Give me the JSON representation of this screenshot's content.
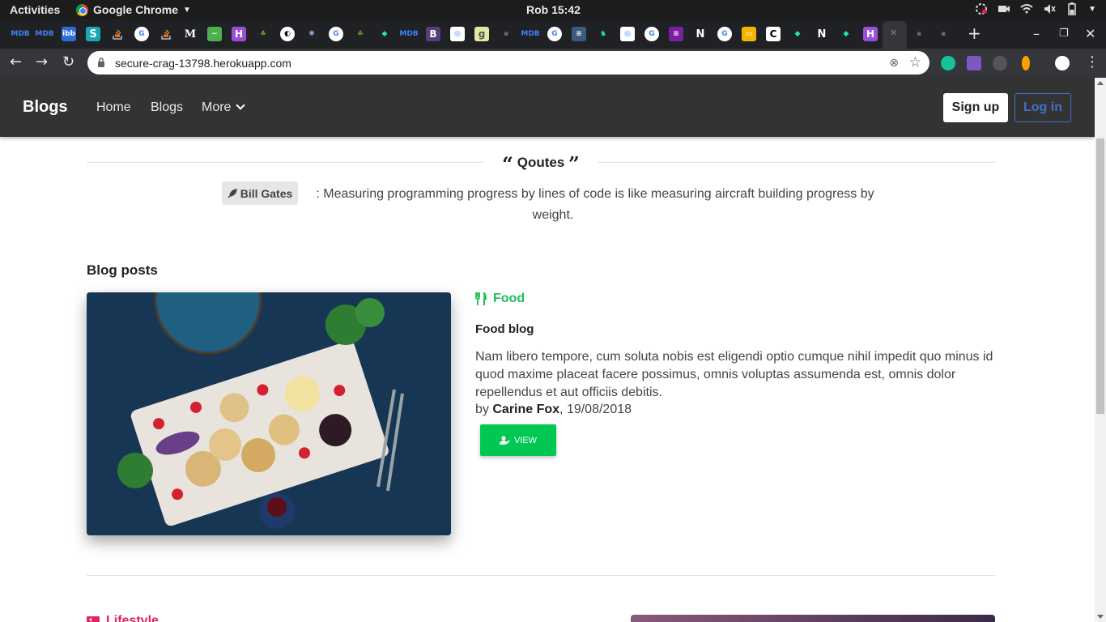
{
  "os": {
    "activities": "Activities",
    "app_name": "Google Chrome",
    "clock": "Rob 15:42"
  },
  "browser": {
    "url": "secure-crag-13798.herokuapp.com",
    "tab_labels": [
      "MDB",
      "MDB",
      "ibb",
      "S",
      "M",
      "H",
      "B",
      "g",
      "N",
      "C",
      "N"
    ]
  },
  "site": {
    "brand": "Blogs",
    "nav": {
      "home": "Home",
      "blogs": "Blogs",
      "more": "More"
    },
    "signup": "Sign up",
    "login": "Log in"
  },
  "quotes": {
    "heading": "Qoutes",
    "author": "Bill Gates",
    "text": ": Measuring programming progress by lines of code is like measuring aircraft building progress by weight."
  },
  "blog": {
    "section_title": "Blog posts",
    "posts": [
      {
        "category": "Food",
        "title": "Food blog",
        "excerpt": "Nam libero tempore, cum soluta nobis est eligendi optio cumque nihil impedit quo minus id quod maxime placeat facere possimus, omnis voluptas assumenda est, omnis dolor repellendus et aut officiis debitis.",
        "by": "by",
        "author": "Carine Fox",
        "date": ", 19/08/2018",
        "button": "VIEW"
      },
      {
        "category": "Lifestyle"
      }
    ]
  },
  "colors": {
    "navbar": "#333333",
    "food_accent": "#1fbf57",
    "view_button": "#00c853",
    "lifestyle_accent": "#e0245e",
    "login_accent": "#3f72c8"
  }
}
